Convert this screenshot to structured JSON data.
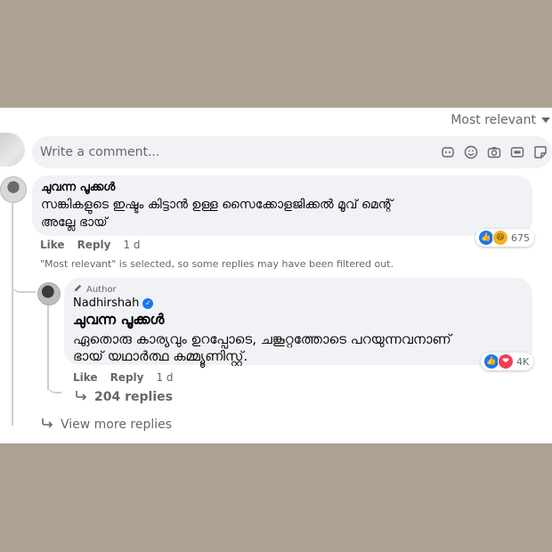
{
  "sort": {
    "label": "Most relevant"
  },
  "composer": {
    "placeholder": "Write a comment..."
  },
  "comment": {
    "author": "ചുവന്ന പൂക്കൾ",
    "text_line1": "സങ്കികളുടെ ഇഷ്ടം കിട്ടാൻ ഉള്ള സൈക്കോളജിക്കൽ മൂവ് മെന്റ്",
    "text_line2": "അല്ലേ ഭായ്",
    "like_label": "Like",
    "reply_label": "Reply",
    "time": "1 d",
    "reactions_count": "675"
  },
  "notice": "\"Most relevant\" is selected, so some replies may have been filtered out.",
  "reply": {
    "badge": "Author",
    "author": "Nadhirshah",
    "mention": "ചുവന്ന പൂക്കൾ",
    "text_line1": "ഏതൊരു കാര്യവും ഉറപ്പോടെ, ചങ്കൂറ്റത്തോടെ പറയുന്നവനാണ്",
    "text_line2": "ഭായ് യഥാർത്ഥ കമ്മ്യൂണിസ്റ്റ്.",
    "like_label": "Like",
    "reply_label": "Reply",
    "time": "1 d",
    "reactions_count": "4K",
    "replies_label": "204 replies"
  },
  "view_more": "View more replies"
}
